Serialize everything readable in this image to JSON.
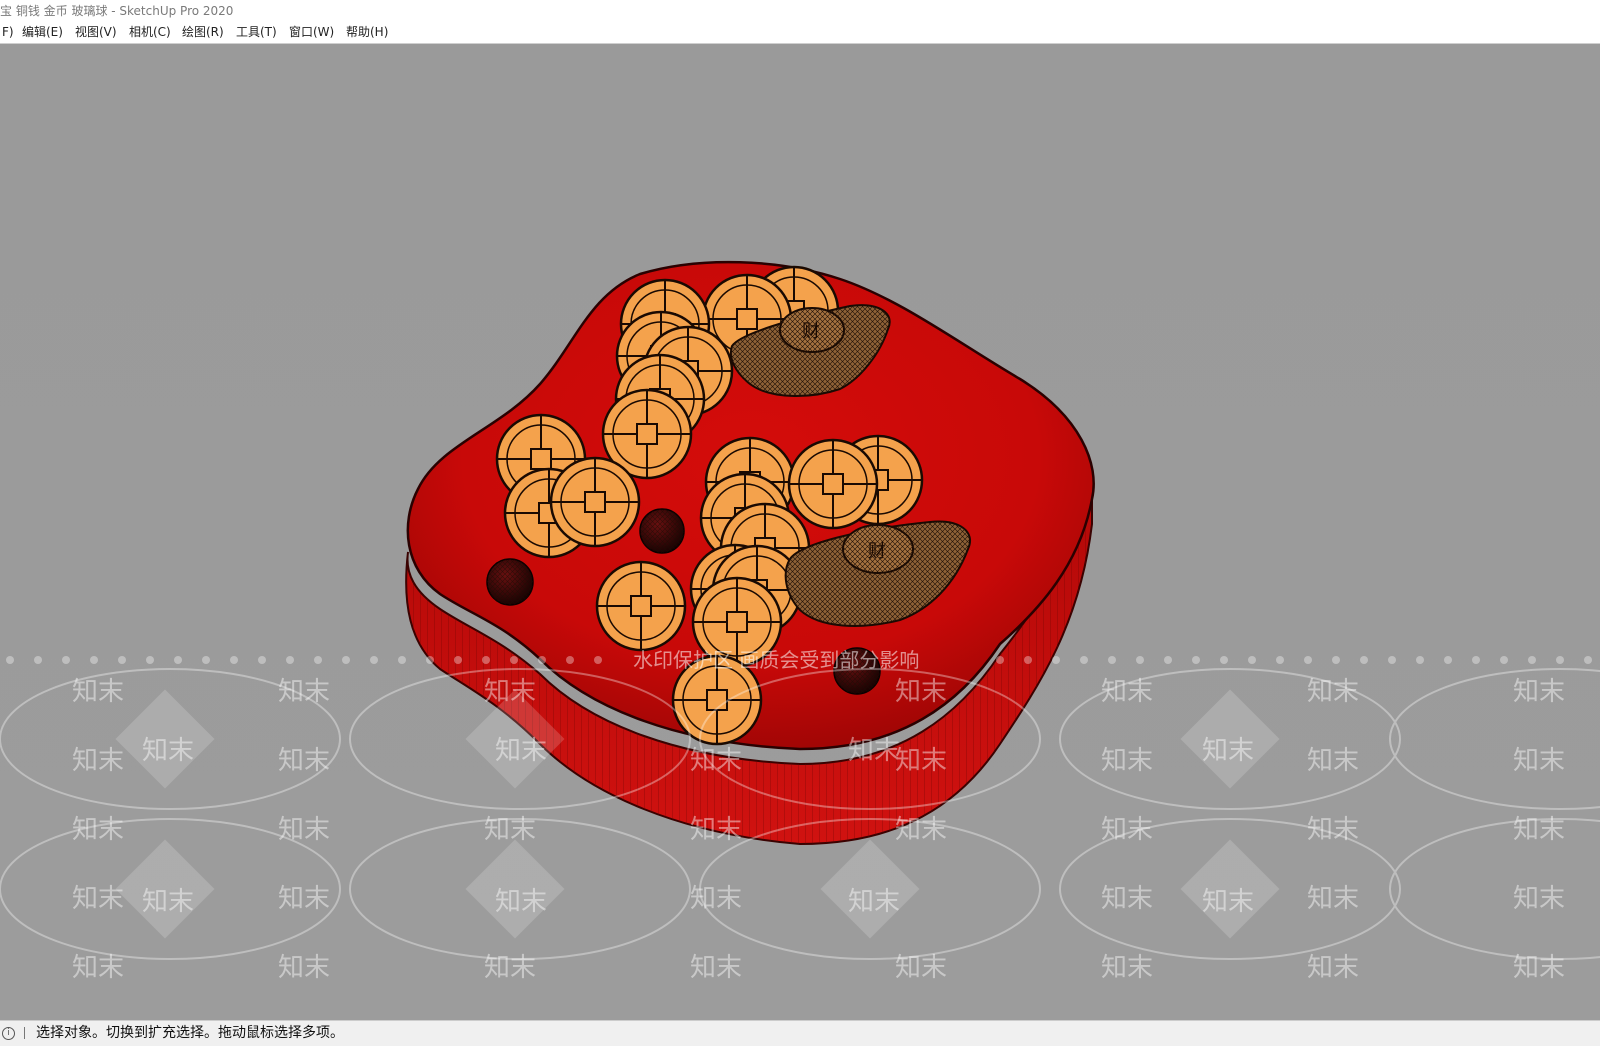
{
  "window": {
    "title": "宝 铜钱 金币 玻璃球 - SketchUp Pro 2020"
  },
  "menu": {
    "items": [
      {
        "id": "file",
        "label": "F)"
      },
      {
        "id": "edit",
        "label": "编辑(E)"
      },
      {
        "id": "view",
        "label": "视图(V)"
      },
      {
        "id": "camera",
        "label": "相机(C)"
      },
      {
        "id": "draw",
        "label": "绘图(R)"
      },
      {
        "id": "tools",
        "label": "工具(T)"
      },
      {
        "id": "window",
        "label": "窗口(W)"
      },
      {
        "id": "help",
        "label": "帮助(H)"
      }
    ]
  },
  "viewport": {
    "background": "#9b9b9b",
    "watermark": {
      "banner": "水印保护区  画质会受到部分影响",
      "brand": "知末"
    },
    "model": {
      "base_color": "#cc0a08",
      "coin_color": "#f5a04a",
      "ingot_color": "#9a6a3a",
      "marble_color": "#3a0505",
      "objects": [
        "red-base",
        "copper-coins",
        "gold-ingots",
        "glass-marbles"
      ]
    }
  },
  "status": {
    "info_icon": "info-icon",
    "text": "选择对象。切换到扩充选择。拖动鼠标选择多项。"
  }
}
